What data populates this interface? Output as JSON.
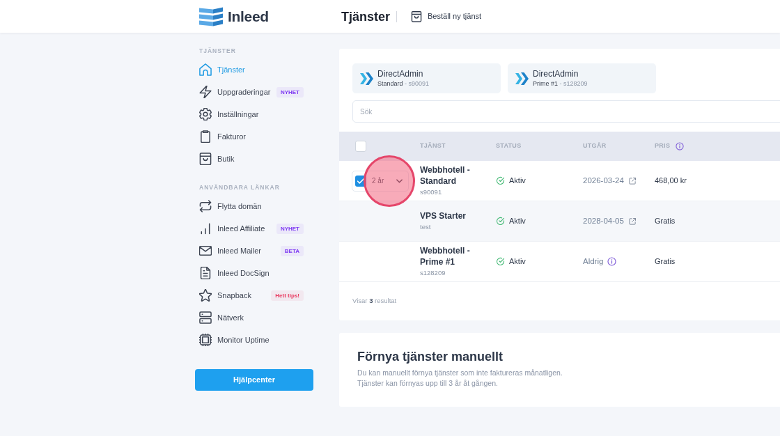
{
  "header": {
    "logo": "Inleed",
    "title": "Tjänster",
    "order_link": "Beställ ny tjänst"
  },
  "sidebar": {
    "sections": [
      {
        "heading": "TJÄNSTER",
        "items": [
          {
            "label": "Tjänster",
            "selected": true
          },
          {
            "label": "Uppgraderingar",
            "selected": false,
            "badge": {
              "text": "NYHET",
              "color": "#7e3af2"
            }
          },
          {
            "label": "Inställningar",
            "selected": false
          },
          {
            "label": "Fakturor",
            "selected": false
          },
          {
            "label": "Butik",
            "selected": false
          }
        ]
      },
      {
        "heading": "ANVÄNDBARA LÄNKAR",
        "items": [
          {
            "label": "Flytta domän",
            "selected": false
          },
          {
            "label": "Inleed Affiliate",
            "selected": false,
            "badge": {
              "text": "NYHET",
              "color": "#7e3af2"
            }
          },
          {
            "label": "Inleed Mailer",
            "selected": false,
            "badge": {
              "text": "BETA",
              "color": "#7e3af2"
            }
          },
          {
            "label": "Inleed DocSign",
            "selected": false
          },
          {
            "label": "Snapback",
            "selected": false,
            "badge": {
              "text": "Hett tips!",
              "color": "#e8365d"
            }
          },
          {
            "label": "Nätverk",
            "selected": false
          },
          {
            "label": "Monitor Uptime",
            "selected": false
          }
        ]
      }
    ],
    "help_button": "Hjälpcenter"
  },
  "service_cards": [
    {
      "title": "DirectAdmin",
      "subtitle": "**Standard** - s90091"
    },
    {
      "title": "DirectAdmin",
      "subtitle": "**Prime #1** - s128209"
    }
  ],
  "search": {
    "placeholder": "Sök"
  },
  "services_table": {
    "select_all": {
      "checked": false
    },
    "columns": [
      {
        "label": "TJÄNST",
        "info": false
      },
      {
        "label": "STATUS",
        "info": false
      },
      {
        "label": "UTGÅR",
        "info": false
      },
      {
        "label": "PRIS",
        "info": true
      }
    ],
    "rows": [
      {
        "renewal": {
          "checked": true,
          "period": "2 år",
          "highlighted": true
        },
        "name": "Webbhotell - Standard",
        "id": "s90091",
        "status": {
          "text": "Aktiv",
          "kind": "active"
        },
        "expires": {
          "text": "2026-03-24",
          "kind": "date"
        },
        "price": "468,00 kr"
      },
      {
        "name": "VPS Starter",
        "id": "test",
        "status": {
          "text": "Aktiv",
          "kind": "active"
        },
        "expires": {
          "text": "2028-04-05",
          "kind": "date"
        },
        "price": "Gratis"
      },
      {
        "name": "Webbhotell - Prime #1",
        "id": "s128209",
        "status": {
          "text": "Aktiv",
          "kind": "active"
        },
        "expires": {
          "text": "Aldrig",
          "kind": "never"
        },
        "price": "Gratis"
      }
    ],
    "footer": "Visar **3** resultat"
  },
  "renew_card": {
    "title": "Förnya tjänster manuellt",
    "lines": [
      "Du kan manuellt förnya tjänster som inte faktureras månatligen.",
      "Tjänster kan förnyas upp till 3 år åt gången."
    ]
  }
}
